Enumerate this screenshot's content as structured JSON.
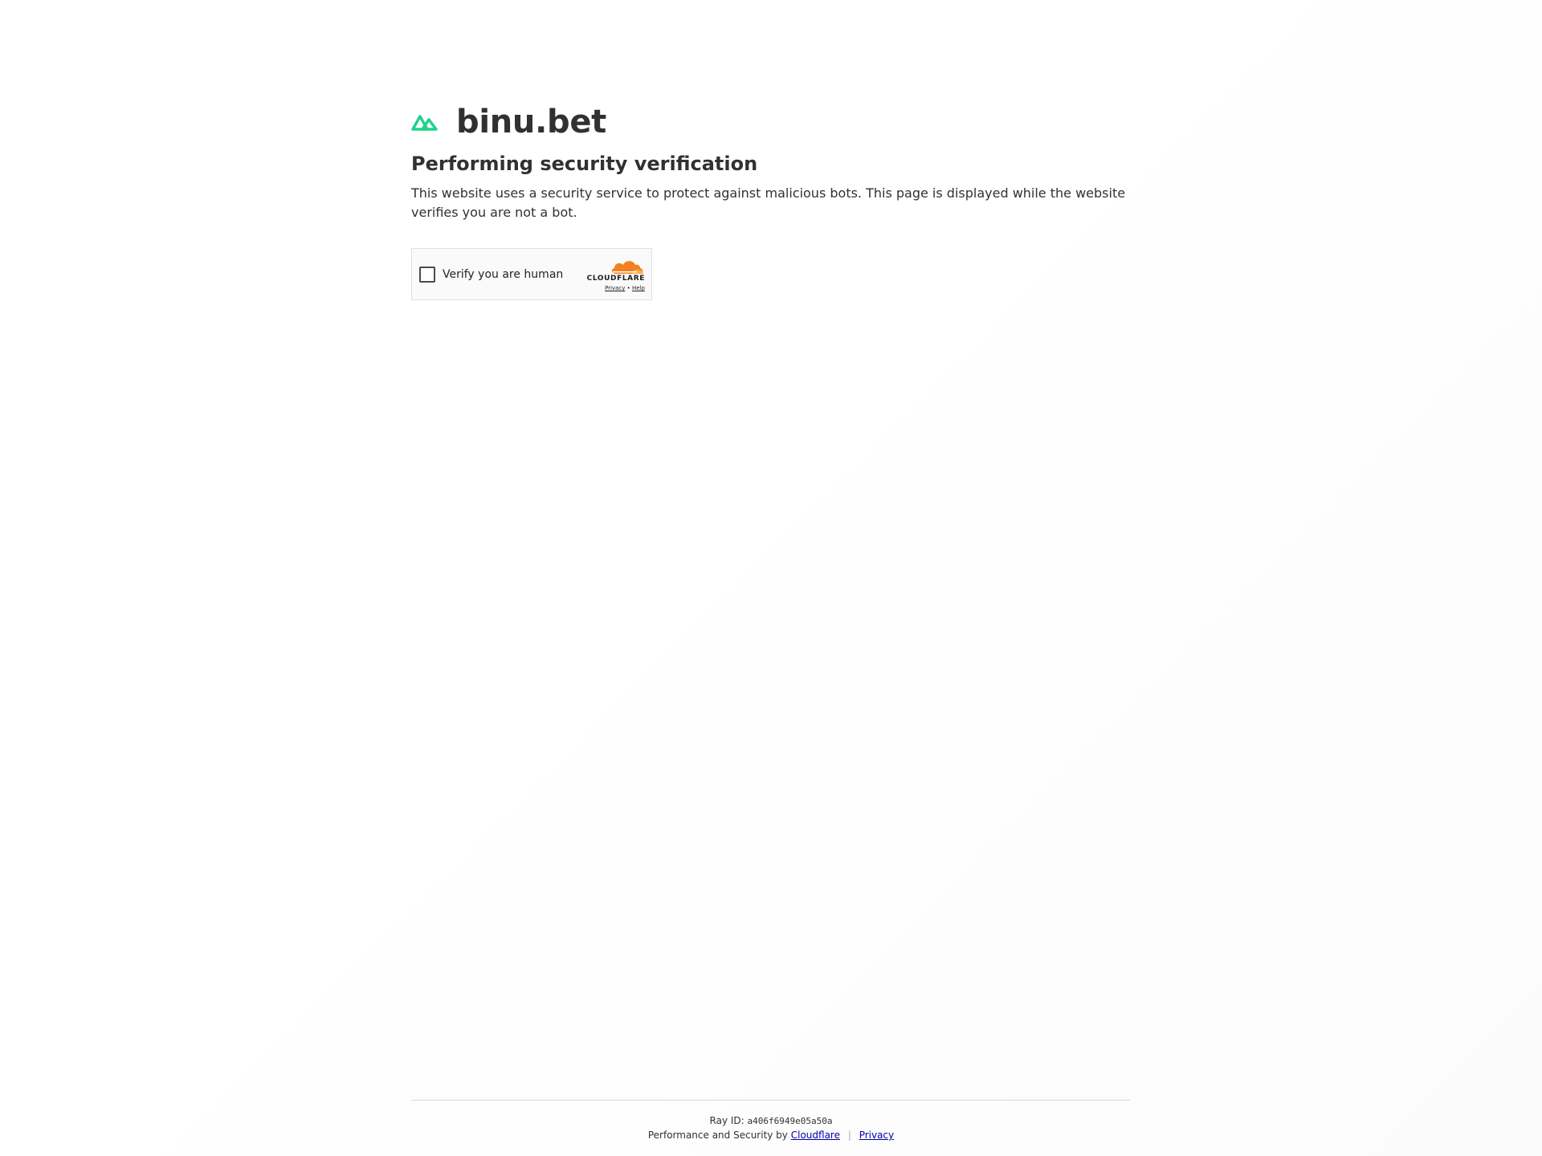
{
  "site": {
    "name": "binu.bet",
    "logo_icon": "mountain-logo-icon",
    "brand_color": "#1fd38b"
  },
  "main": {
    "title": "Performing security verification",
    "description": "This website uses a security service to protect against malicious bots. This page is displayed while the website verifies you are not a bot."
  },
  "widget": {
    "checkbox_label": "Verify you are human",
    "provider_name": "CLOUDFLARE",
    "provider_icon": "cloudflare-cloud-icon",
    "privacy_link": "Privacy",
    "link_separator": "•",
    "help_link": "Help",
    "accent_color": "#f38020"
  },
  "footer": {
    "ray_label": "Ray ID:",
    "ray_id": "a406f6949e05a50a",
    "perf_prefix": "Performance and Security by",
    "cloudflare_link": "Cloudflare",
    "separator": "|",
    "privacy_link": "Privacy",
    "link_color": "#0000aa"
  }
}
